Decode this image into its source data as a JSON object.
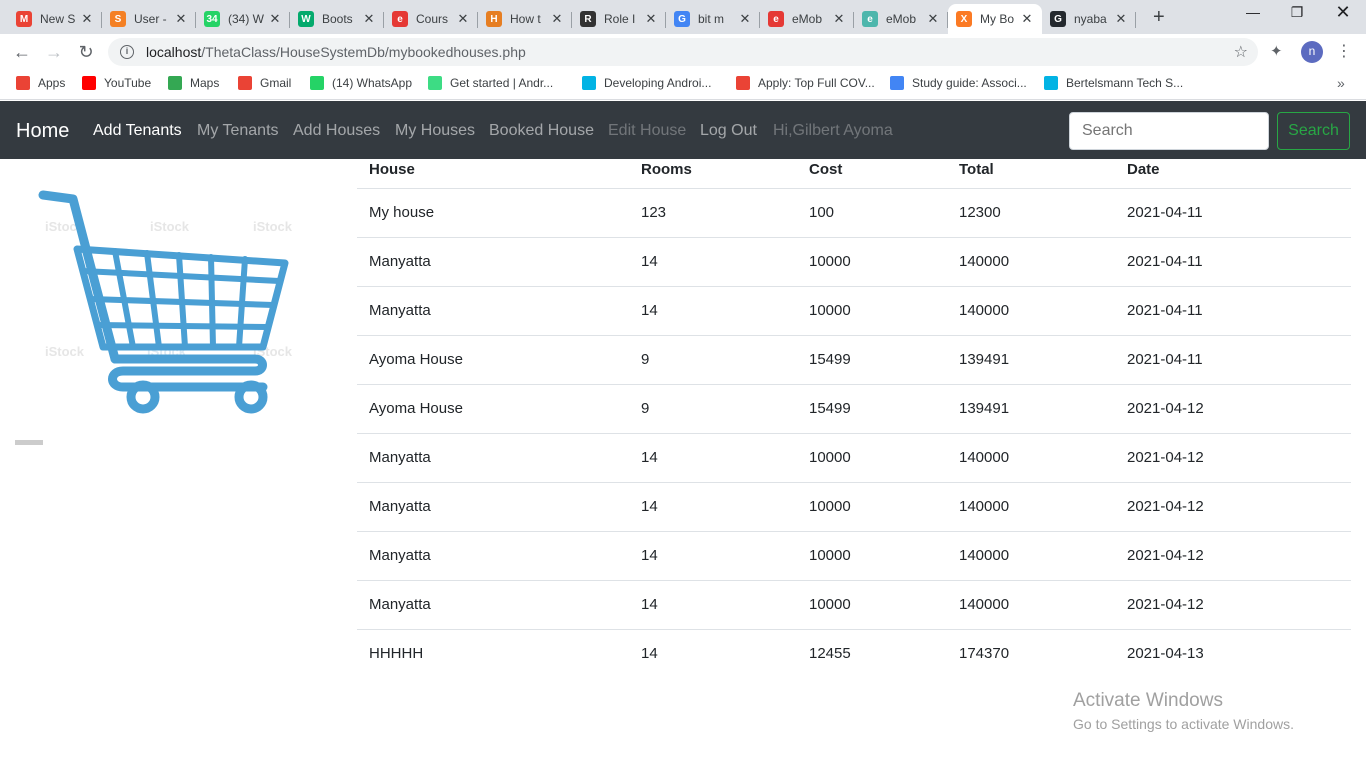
{
  "browser": {
    "tabs": [
      {
        "title": "New S",
        "icon": "gmail-icon",
        "color": "#ea4335",
        "glyph": "M"
      },
      {
        "title": "User -",
        "icon": "stackoverflow-icon",
        "color": "#f48024",
        "glyph": "S"
      },
      {
        "title": "(34) W",
        "icon": "whatsapp-icon",
        "color": "#25d366",
        "glyph": "34"
      },
      {
        "title": "Boots",
        "icon": "w3schools-icon",
        "color": "#04aa6d",
        "glyph": "W"
      },
      {
        "title": "Cours",
        "icon": "emobilis-icon",
        "color": "#e53935",
        "glyph": "e"
      },
      {
        "title": "How t",
        "icon": "tutorial-icon",
        "color": "#e67e22",
        "glyph": "H"
      },
      {
        "title": "Role I",
        "icon": "role-icon",
        "color": "#333333",
        "glyph": "R"
      },
      {
        "title": "bit m",
        "icon": "google-icon",
        "color": "#4285f4",
        "glyph": "G"
      },
      {
        "title": "eMob",
        "icon": "emobilis-icon",
        "color": "#e53935",
        "glyph": "e"
      },
      {
        "title": "eMob",
        "icon": "emobilis-globe-icon",
        "color": "#4db6ac",
        "glyph": "e"
      },
      {
        "title": "My Bo",
        "icon": "xampp-icon",
        "color": "#fb7a24",
        "glyph": "X",
        "active": true
      },
      {
        "title": "nyaba",
        "icon": "github-icon",
        "color": "#24292e",
        "glyph": "G"
      }
    ],
    "url_host": "localhost",
    "url_path": "/ThetaClass/HouseSystemDb/mybookedhouses.php",
    "profile_initial": "n",
    "bookmarks": [
      {
        "label": "Apps",
        "icon": "apps-grid-icon",
        "color": "#ea4335"
      },
      {
        "label": "YouTube",
        "icon": "youtube-icon",
        "color": "#ff0000"
      },
      {
        "label": "Maps",
        "icon": "maps-icon",
        "color": "#34a853"
      },
      {
        "label": "Gmail",
        "icon": "gmail-icon",
        "color": "#ea4335"
      },
      {
        "label": "(14) WhatsApp",
        "icon": "whatsapp-icon",
        "color": "#25d366"
      },
      {
        "label": "Get started | Andr...",
        "icon": "android-icon",
        "color": "#3ddc84"
      },
      {
        "label": "Developing Androi...",
        "icon": "udacity-icon",
        "color": "#02b3e4"
      },
      {
        "label": "Apply: Top Full COV...",
        "icon": "gmail-icon",
        "color": "#ea4335"
      },
      {
        "label": "Study guide: Associ...",
        "icon": "code-icon",
        "color": "#4285f4"
      },
      {
        "label": "Bertelsmann Tech S...",
        "icon": "udacity-icon",
        "color": "#02b3e4"
      }
    ]
  },
  "navbar": {
    "brand": "Home",
    "links": [
      {
        "label": "Add Tenants",
        "state": "active"
      },
      {
        "label": "My Tenants",
        "state": "normal"
      },
      {
        "label": "Add Houses",
        "state": "normal"
      },
      {
        "label": "My Houses",
        "state": "normal"
      },
      {
        "label": "Booked House",
        "state": "normal"
      },
      {
        "label": "Edit House",
        "state": "disabled"
      },
      {
        "label": "Log Out",
        "state": "normal"
      },
      {
        "label": "Hi,Gilbert Ayoma",
        "state": "disabled"
      }
    ],
    "search_placeholder": "Search",
    "search_button": "Search"
  },
  "watermark": {
    "text": "iStock"
  },
  "table": {
    "columns": [
      "House",
      "Rooms",
      "Cost",
      "Total",
      "Date"
    ],
    "rows": [
      [
        "My house",
        "123",
        "100",
        "12300",
        "2021-04-11"
      ],
      [
        "Manyatta",
        "14",
        "10000",
        "140000",
        "2021-04-11"
      ],
      [
        "Manyatta",
        "14",
        "10000",
        "140000",
        "2021-04-11"
      ],
      [
        "Ayoma House",
        "9",
        "15499",
        "139491",
        "2021-04-11"
      ],
      [
        "Ayoma House",
        "9",
        "15499",
        "139491",
        "2021-04-12"
      ],
      [
        "Manyatta",
        "14",
        "10000",
        "140000",
        "2021-04-12"
      ],
      [
        "Manyatta",
        "14",
        "10000",
        "140000",
        "2021-04-12"
      ],
      [
        "Manyatta",
        "14",
        "10000",
        "140000",
        "2021-04-12"
      ],
      [
        "Manyatta",
        "14",
        "10000",
        "140000",
        "2021-04-12"
      ],
      [
        "HHHHH",
        "14",
        "12455",
        "174370",
        "2021-04-13"
      ]
    ]
  },
  "activation": {
    "title": "Activate Windows",
    "subtitle": "Go to Settings to activate Windows."
  },
  "colors": {
    "cart": "#4a9fd4",
    "navbar_bg": "#343a40",
    "search_green": "#28a745"
  }
}
